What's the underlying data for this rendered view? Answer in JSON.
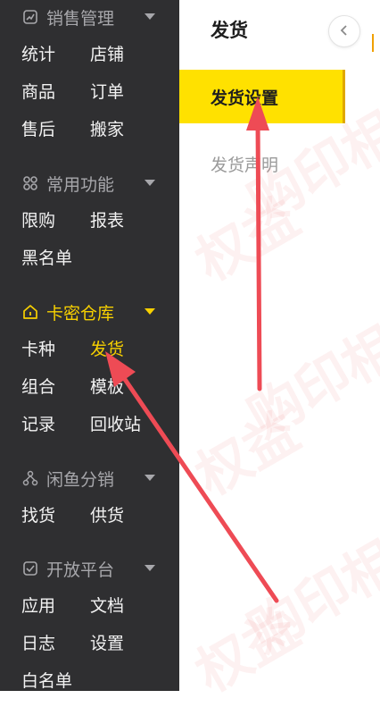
{
  "sidebar": {
    "groups": [
      {
        "title": "销售管理",
        "icon": "sales-chart-icon",
        "items": [
          "统计",
          "店铺",
          "商品",
          "订单",
          "售后",
          "搬家"
        ]
      },
      {
        "title": "常用功能",
        "icon": "grid-apps-icon",
        "items": [
          "限购",
          "报表",
          "黑名单"
        ]
      },
      {
        "title": "卡密仓库",
        "icon": "warehouse-icon",
        "items": [
          "卡种",
          "发货",
          "组合",
          "模板",
          "记录",
          "回收站"
        ],
        "active_item": "发货"
      },
      {
        "title": "闲鱼分销",
        "icon": "distribution-network-icon",
        "items": [
          "找货",
          "供货"
        ]
      },
      {
        "title": "开放平台",
        "icon": "platform-check-icon",
        "items": [
          "应用",
          "文档",
          "日志",
          "设置",
          "白名单"
        ]
      }
    ]
  },
  "subpanel": {
    "title": "发货",
    "items": [
      "发货设置",
      "发货声明"
    ],
    "active_item": "发货设置"
  },
  "watermark": {
    "texts": [
      "权益",
      "购印相",
      "权益",
      "购印相",
      "权益",
      "购印相"
    ]
  },
  "colors": {
    "sidebar_bg": "#2f2f31",
    "accent": "#f7d000",
    "active_bg": "#ffe100",
    "arrow": "#ee4b55"
  }
}
